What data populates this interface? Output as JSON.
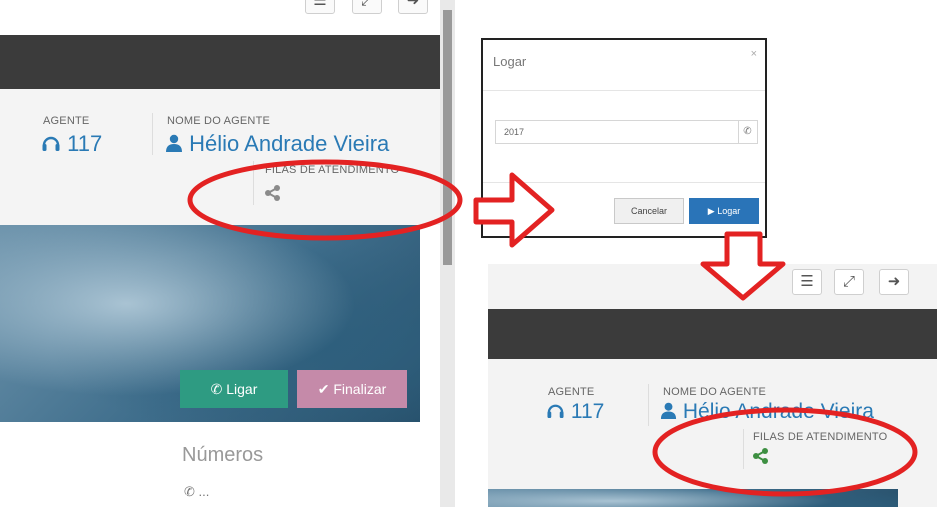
{
  "left_panel": {
    "toolbar_icons": [
      "menu-icon",
      "expand-icon",
      "logout-icon"
    ],
    "agent_label": "AGENTE",
    "agent_number": "117",
    "agent_name_label": "NOME DO AGENTE",
    "agent_name": "Hélio Andrade Vieira",
    "queues_label": "FILAS DE ATENDIMENTO",
    "ligar_label": "Ligar",
    "finalizar_label": "Finalizar",
    "numbers_title": "Números",
    "phone_placeholder": "..."
  },
  "login_dialog": {
    "title": "Logar",
    "close_symbol": "×",
    "extension_value": "2017",
    "cancel_label": "Cancelar",
    "login_label": "Logar"
  },
  "result_panel": {
    "toolbar_icons": [
      "menu-icon",
      "expand-icon",
      "logout-icon"
    ],
    "agent_label": "AGENTE",
    "agent_number": "117",
    "agent_name_label": "NOME DO AGENTE",
    "agent_name": "Hélio Andrade Vieira",
    "queues_label": "FILAS DE ATENDIMENTO"
  },
  "colors": {
    "accent_blue": "#2a7ab5",
    "ligar_green": "#2e9b82",
    "finalizar_pink": "#c58aa9",
    "annotation_red": "#e32222",
    "queue_active_green": "#3d8f41"
  }
}
